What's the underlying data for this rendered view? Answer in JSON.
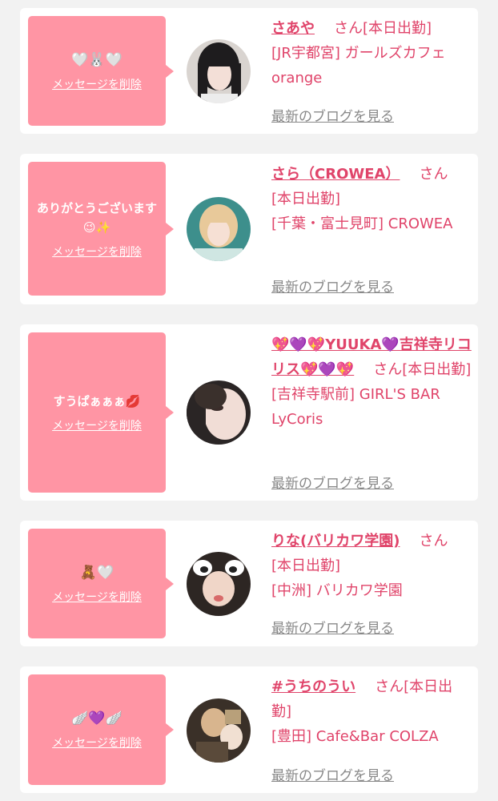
{
  "cards": [
    {
      "message": "🤍🐰🤍",
      "delete_label": "メッセージを削除",
      "name": "さあや",
      "suffix": "さん",
      "status": "[本日出勤]",
      "shop": "[JR宇都宮] ガールズカフェ orange",
      "blog_label": "最新のブログを見る"
    },
    {
      "message": "ありがとうございます😉✨",
      "delete_label": "メッセージを削除",
      "name": "さら（CROWEA）",
      "suffix": "さん",
      "status": "[本日出勤]",
      "shop": "[千葉・富士見町] CROWEA",
      "blog_label": "最新のブログを見る"
    },
    {
      "message": "すうぱぁぁぁ💋",
      "delete_label": "メッセージを削除",
      "name": "💖💜💖YUUKA💜吉祥寺リコリス💖💜💖",
      "suffix": "さん",
      "status": "[本日出勤]",
      "shop": "[吉祥寺駅前] GIRL'S BAR LyCoris",
      "blog_label": "最新のブログを見る"
    },
    {
      "message": "🧸🤍",
      "delete_label": "メッセージを削除",
      "name": "りな(バリカワ学園)",
      "suffix": "さん",
      "status": "[本日出勤]",
      "shop": "[中洲] バリカワ学園",
      "blog_label": "最新のブログを見る"
    },
    {
      "message": "🪽💜🪽",
      "delete_label": "メッセージを削除",
      "name": "#うちのうい",
      "suffix": "さん",
      "status": "[本日出勤]",
      "shop": "[豊田] Cafe&Bar COLZA",
      "blog_label": "最新のブログを見る"
    }
  ],
  "colors": {
    "accent": "#e0446a",
    "bubble": "#ff95a4",
    "muted": "#888888",
    "background": "#f2f2f2"
  }
}
